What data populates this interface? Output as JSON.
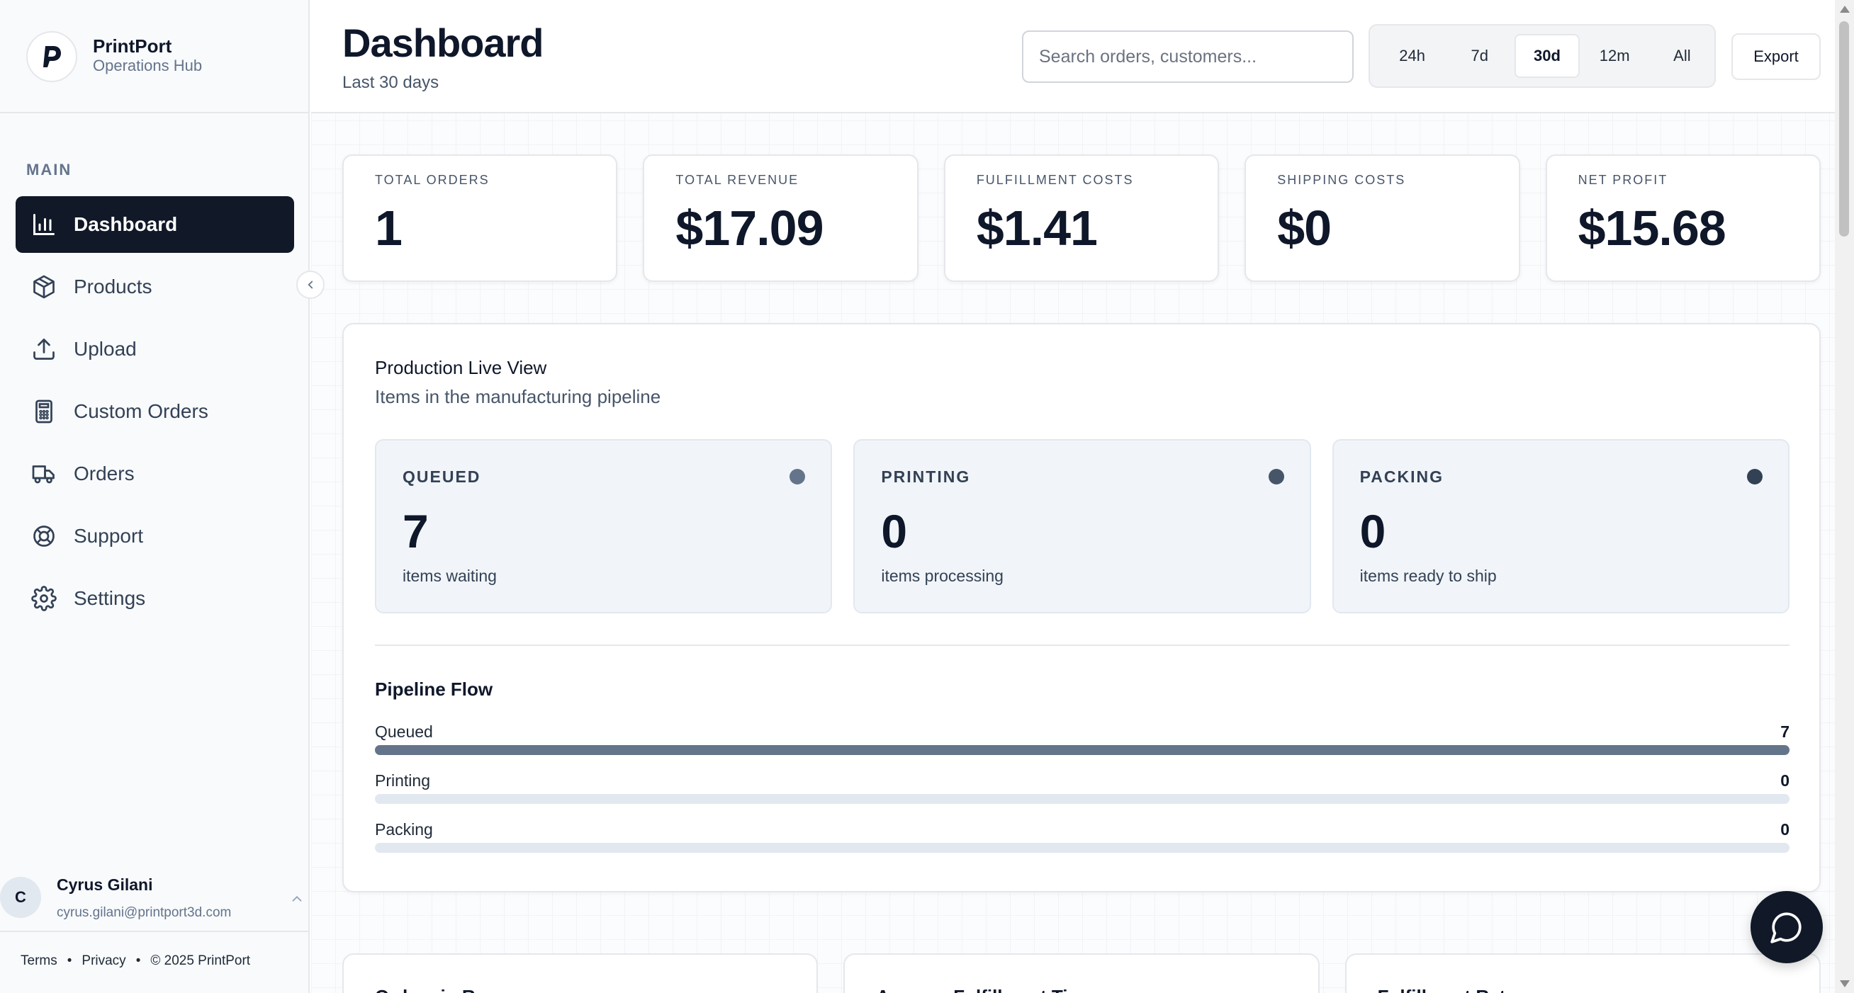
{
  "brand": {
    "name": "PrintPort",
    "subtitle": "Operations Hub",
    "logo_icon": "printport-logo-icon"
  },
  "sidebar": {
    "section_label": "MAIN",
    "items": [
      {
        "label": "Dashboard",
        "icon": "bar-chart-icon",
        "active": true
      },
      {
        "label": "Products",
        "icon": "box-icon",
        "active": false
      },
      {
        "label": "Upload",
        "icon": "upload-icon",
        "active": false
      },
      {
        "label": "Custom Orders",
        "icon": "calculator-icon",
        "active": false
      },
      {
        "label": "Orders",
        "icon": "truck-icon",
        "active": false
      },
      {
        "label": "Support",
        "icon": "lifebuoy-icon",
        "active": false
      },
      {
        "label": "Settings",
        "icon": "gear-icon",
        "active": false
      }
    ],
    "collapse_icon": "chevron-left-icon"
  },
  "user": {
    "initial": "C",
    "name": "Cyrus Gilani",
    "email": "cyrus.gilani@printport3d.com"
  },
  "footer": {
    "terms": "Terms",
    "separator": "•",
    "privacy": "Privacy",
    "copyright": "© 2025 PrintPort"
  },
  "header": {
    "title": "Dashboard",
    "subtitle": "Last 30 days",
    "search_placeholder": "Search orders, customers...",
    "search_value": "",
    "ranges": [
      "24h",
      "7d",
      "30d",
      "12m",
      "All"
    ],
    "selected_range": "30d",
    "export_label": "Export"
  },
  "kpis": [
    {
      "label": "TOTAL ORDERS",
      "value": "1"
    },
    {
      "label": "TOTAL REVENUE",
      "value": "$17.09"
    },
    {
      "label": "FULFILLMENT COSTS",
      "value": "$1.41"
    },
    {
      "label": "SHIPPING COSTS",
      "value": "$0"
    },
    {
      "label": "NET PROFIT",
      "value": "$15.68"
    }
  ],
  "production": {
    "title": "Production Live View",
    "subtitle": "Items in the manufacturing pipeline",
    "stages": [
      {
        "name": "QUEUED",
        "count": "7",
        "desc": "items waiting",
        "dot_color": "#64748b"
      },
      {
        "name": "PRINTING",
        "count": "0",
        "desc": "items processing",
        "dot_color": "#475569"
      },
      {
        "name": "PACKING",
        "count": "0",
        "desc": "items ready to ship",
        "dot_color": "#334155"
      }
    ],
    "flow_title": "Pipeline Flow",
    "flow": [
      {
        "label": "Queued",
        "count": "7",
        "fill_fraction": 1.0
      },
      {
        "label": "Printing",
        "count": "0",
        "fill_fraction": 0.0
      },
      {
        "label": "Packing",
        "count": "0",
        "fill_fraction": 0.0
      }
    ]
  },
  "lower_cards": [
    {
      "title": "Orders in R..."
    },
    {
      "title": "Average Fulfillment Ti..."
    },
    {
      "title": "Fulfillment Rat..."
    }
  ],
  "chat_icon": "chat-bubble-icon",
  "colors": {
    "accent_dark": "#111827",
    "text_muted": "#64748b",
    "bar_fill": "#64748b",
    "bar_track": "#e2e8f0"
  }
}
